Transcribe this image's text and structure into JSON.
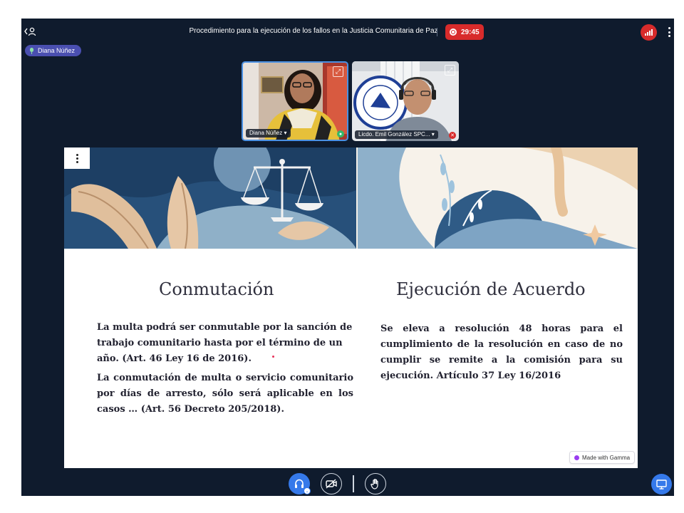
{
  "meeting": {
    "title": "Procedimiento para la ejecución de los fallos en la Justicia Comunitaria de Paz",
    "recording_time": "29:45"
  },
  "talking_indicator": {
    "name": "Diana Núñez"
  },
  "participants": [
    {
      "name": "Diana Núñez"
    },
    {
      "name": "Licdo. Emil González SPC..."
    }
  ],
  "slide": {
    "left": {
      "title": "Conmutación",
      "paragraphs": [
        "La multa podrá ser conmutable por la sanción de trabajo comunitario hasta por el término de un año. (Art. 46 Ley 16 de 2016).",
        "La conmutación de multa o servicio comunitario por días de arresto, sólo será aplicable en los casos … (Art. 56 Decreto 205/2018)."
      ]
    },
    "right": {
      "title": "Ejecución de Acuerdo",
      "paragraph": "Se eleva a resolución 48 horas para el cumplimiento de la resolución  en caso de no cumplir se remite a la comisión para su ejecución. Artículo 37 Ley 16/2016"
    },
    "badge": "Made with Gamma"
  },
  "colors": {
    "app_background": "#0f1b2d",
    "recording_red": "#d82b2b",
    "accent_blue": "#3579ea",
    "talker_purple": "#4a4fb0"
  }
}
